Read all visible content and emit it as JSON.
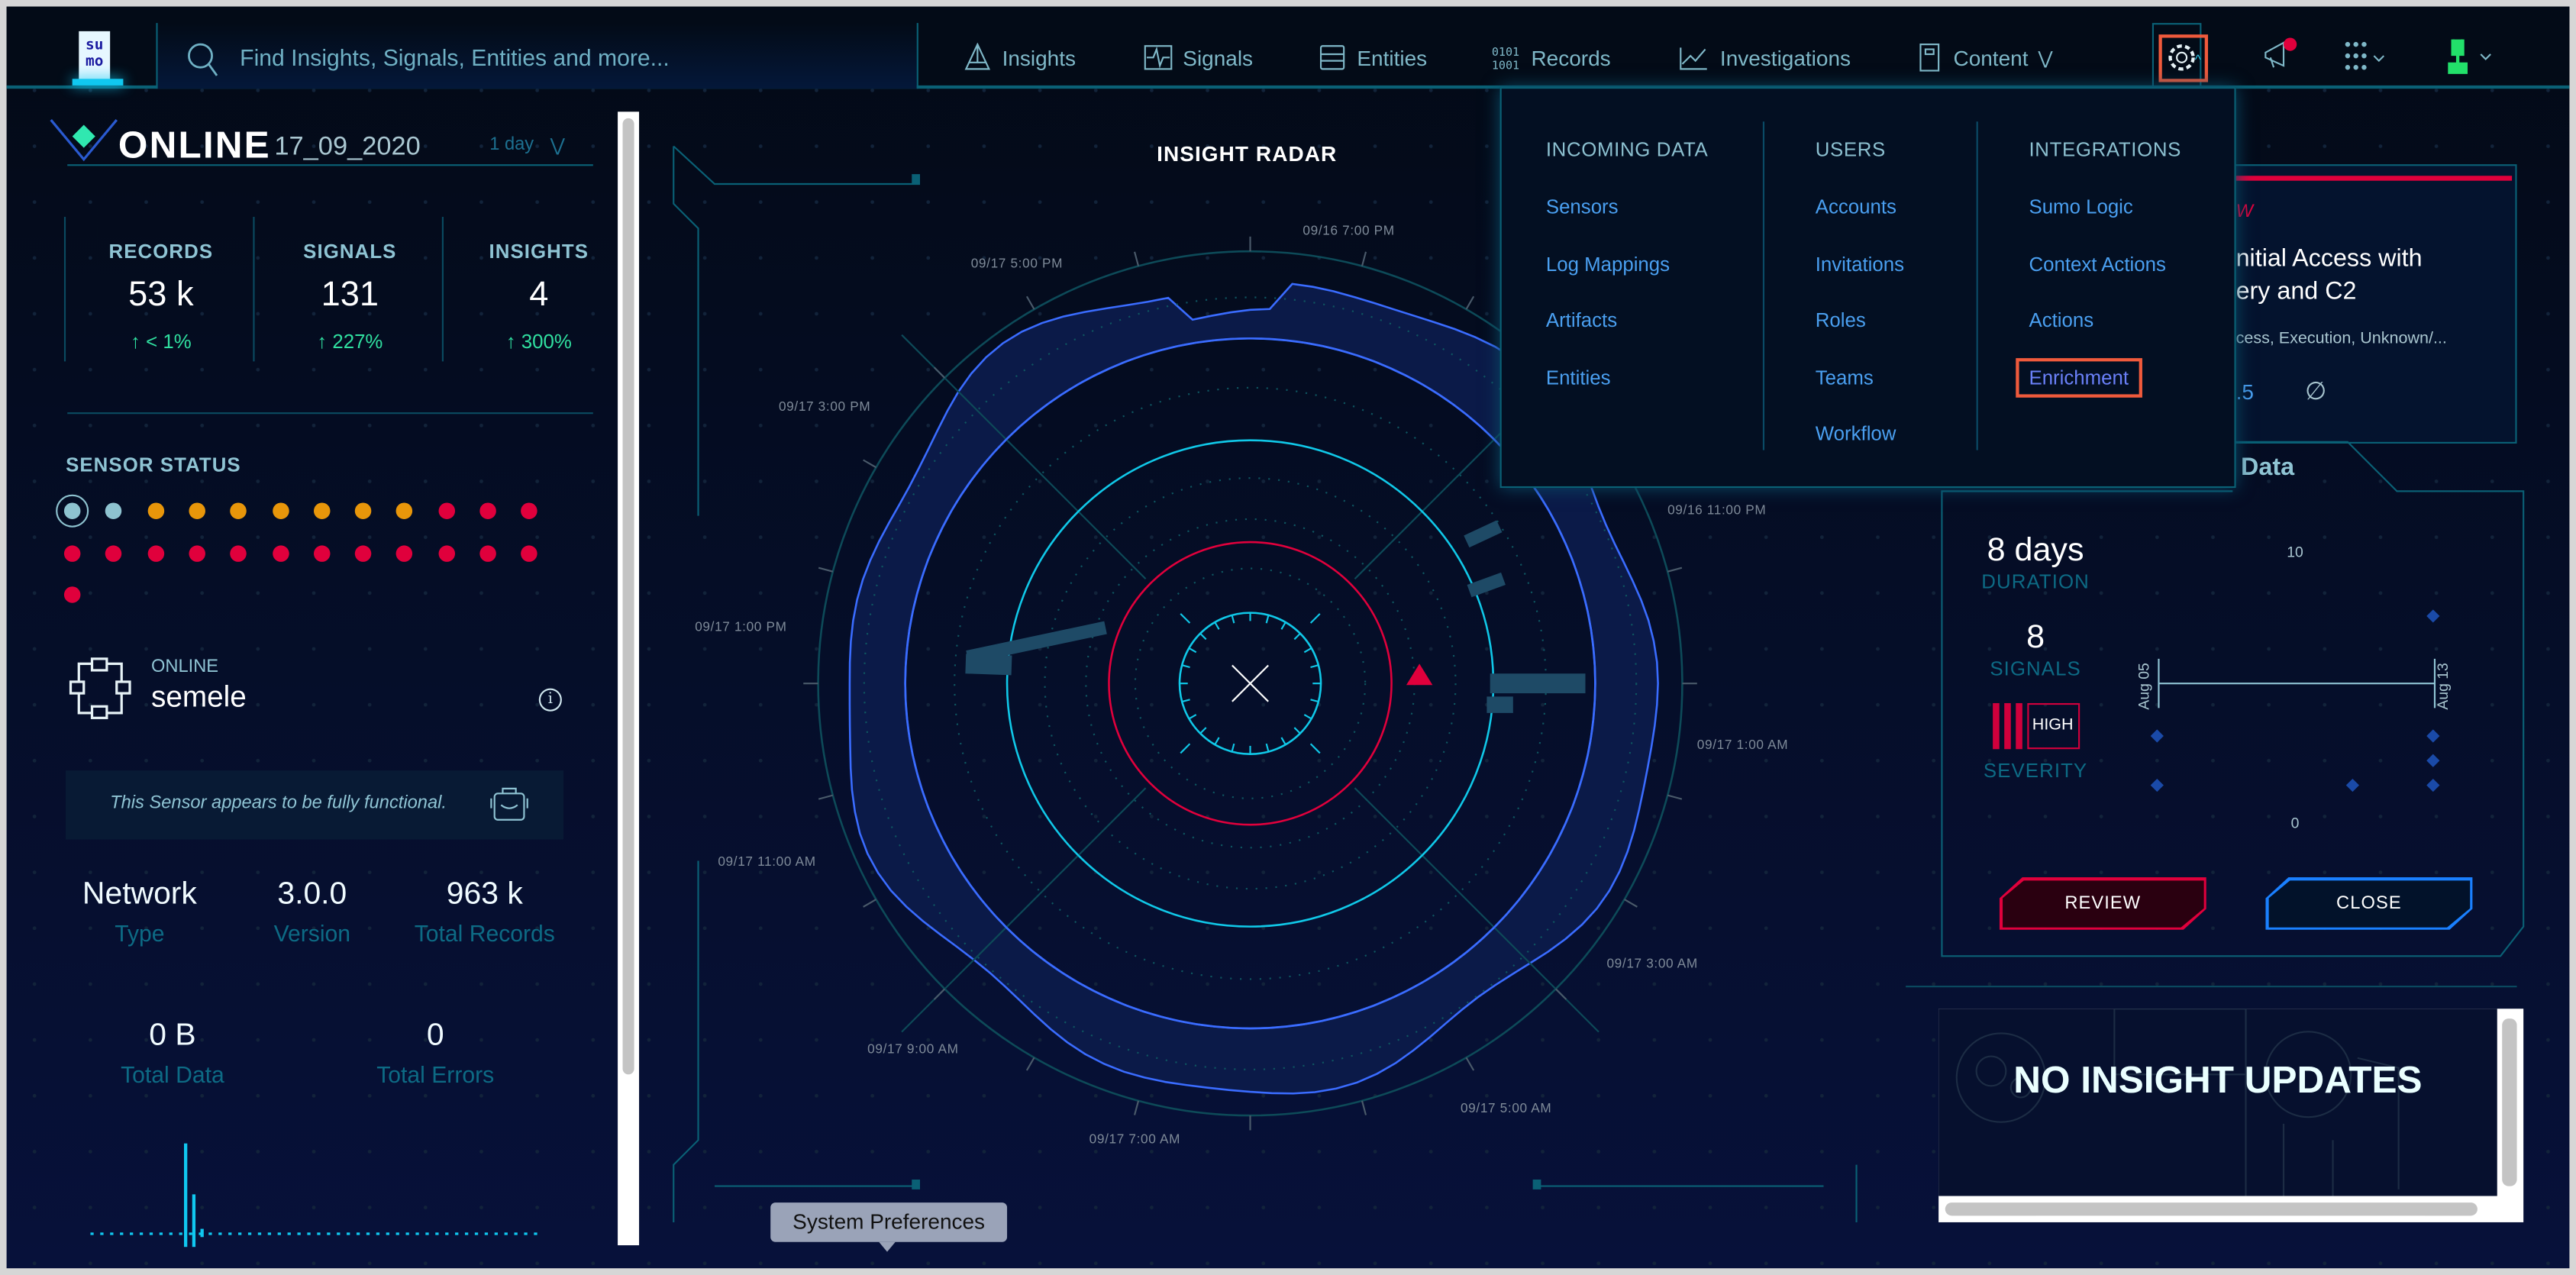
{
  "topbar": {
    "logo_text": "su mo",
    "search_placeholder": "Find Insights, Signals, Entities and more...",
    "nav": [
      {
        "label": "Insights",
        "icon": "triangle-icon"
      },
      {
        "label": "Signals",
        "icon": "pulse-icon"
      },
      {
        "label": "Entities",
        "icon": "server-icon"
      },
      {
        "label": "Records",
        "icon": "binary-icon"
      },
      {
        "label": "Investigations",
        "icon": "chart-icon"
      },
      {
        "label": "Content",
        "icon": "book-icon"
      }
    ],
    "right_icons": [
      "gear-icon",
      "megaphone-icon",
      "apps-grid-icon",
      "user-icon"
    ],
    "notification_color": "#e0003c"
  },
  "left": {
    "status": "ONLINE",
    "date": "17_09_2020",
    "range": "1 day",
    "stats": [
      {
        "label": "RECORDS",
        "value": "53 k",
        "change": "< 1%"
      },
      {
        "label": "SIGNALS",
        "value": "131",
        "change": "227%"
      },
      {
        "label": "INSIGHTS",
        "value": "4",
        "change": "300%"
      }
    ],
    "sensor_status_label": "SENSOR STATUS",
    "sensor_dots": [
      "selected",
      "online",
      "warn",
      "warn",
      "warn",
      "warn",
      "warn",
      "warn",
      "warn",
      "error",
      "error",
      "error",
      "error",
      "error",
      "error",
      "error",
      "error",
      "error",
      "error",
      "error",
      "error",
      "error",
      "error",
      "error",
      "error"
    ],
    "dot_colors": {
      "selected": "#8ec3d0",
      "online": "#8ec3d0",
      "warn": "#e8960a",
      "error": "#e0003c"
    },
    "sensor": {
      "state": "ONLINE",
      "name": "semele",
      "message": "This Sensor appears to be fully functional."
    },
    "details": [
      {
        "value": "Network",
        "label": "Type"
      },
      {
        "value": "3.0.0",
        "label": "Version"
      },
      {
        "value": "963 k",
        "label": "Total Records"
      },
      {
        "value": "0 B",
        "label": "Total Data"
      },
      {
        "value": "0",
        "label": "Total Errors"
      }
    ]
  },
  "radar": {
    "title": "INSIGHT RADAR",
    "labels": [
      "09/16 7:00 PM",
      "09/17 5:00 PM",
      "09/17 3:00 PM",
      "09/17 1:00 PM",
      "09/17 11:00 AM",
      "09/17 9:00 AM",
      "09/17 7:00 AM",
      "09/17 5:00 AM",
      "09/17 3:00 AM",
      "09/17 1:00 AM",
      "09/16 11:00 PM"
    ]
  },
  "dropdown": {
    "columns": [
      {
        "header": "INCOMING DATA",
        "items": [
          "Sensors",
          "Log Mappings",
          "Artifacts",
          "Entities"
        ]
      },
      {
        "header": "USERS",
        "items": [
          "Accounts",
          "Invitations",
          "Roles",
          "Teams",
          "Workflow"
        ]
      },
      {
        "header": "INTEGRATIONS",
        "items": [
          "Sumo Logic",
          "Context Actions",
          "Actions",
          "Enrichment"
        ]
      }
    ],
    "highlighted": "Enrichment"
  },
  "insight": {
    "badge": "W",
    "title_line1": "nitial Access with",
    "title_line2": "ery and C2",
    "tactics": "cess, Execution, Unknown/...",
    "score": ".5",
    "tab": "Data",
    "duration_value": "8 days",
    "duration_label": "DURATION",
    "signals_value": "8",
    "signals_label": "SIGNALS",
    "severity_value": "HIGH",
    "severity_label": "SEVERITY",
    "chart": {
      "y_max": "10",
      "y_min": "0",
      "x_start": "Aug 05",
      "x_end": "Aug 13"
    },
    "review_label": "REVIEW",
    "close_label": "CLOSE"
  },
  "updates": {
    "message": "NO INSIGHT UPDATES"
  },
  "tooltip": {
    "text": "System Preferences"
  }
}
